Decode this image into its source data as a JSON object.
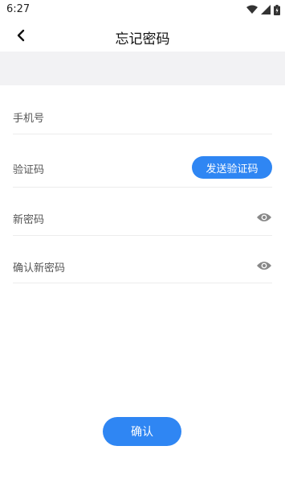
{
  "status_bar": {
    "time": "6:27"
  },
  "header": {
    "title": "忘记密码"
  },
  "form": {
    "phone_label": "手机号",
    "code_label": "验证码",
    "send_code_label": "发送验证码",
    "new_password_label": "新密码",
    "confirm_password_label": "确认新密码"
  },
  "footer": {
    "confirm_label": "确认"
  },
  "colors": {
    "accent": "#2f86f3",
    "band": "#f2f2f4"
  }
}
